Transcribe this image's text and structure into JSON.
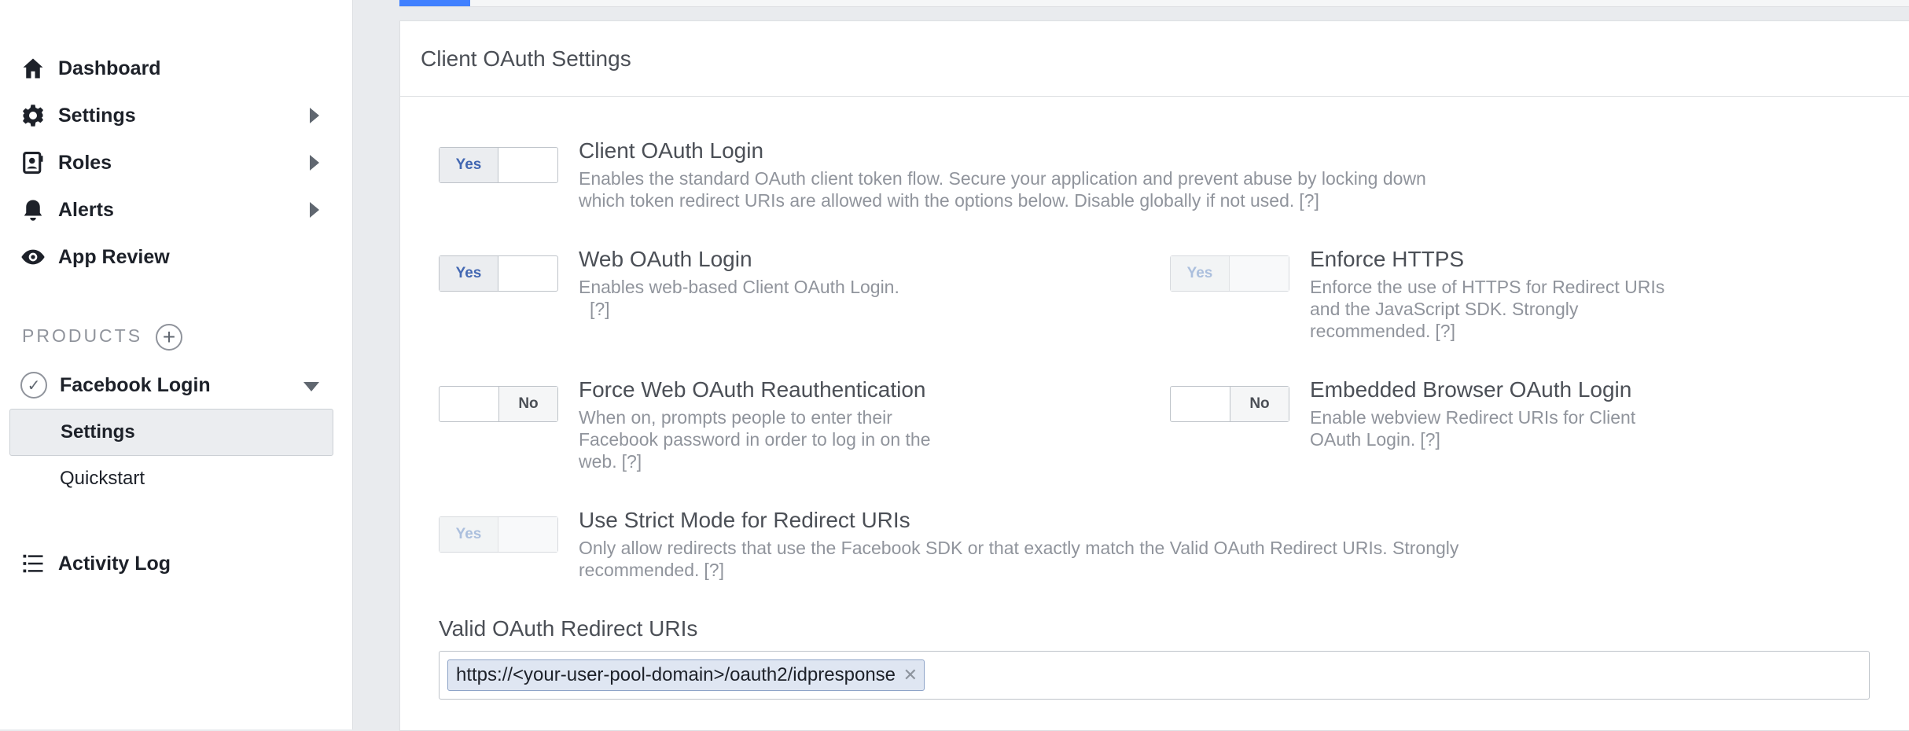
{
  "sidebar": {
    "nav": [
      {
        "label": "Dashboard",
        "icon": "home-icon"
      },
      {
        "label": "Settings",
        "icon": "gear-icon"
      },
      {
        "label": "Roles",
        "icon": "roles-icon"
      },
      {
        "label": "Alerts",
        "icon": "bell-icon"
      },
      {
        "label": "App Review",
        "icon": "eye-icon"
      }
    ],
    "products_label": "PRODUCTS",
    "product": {
      "label": "Facebook Login",
      "sub_items": [
        {
          "label": "Settings",
          "active": true
        },
        {
          "label": "Quickstart",
          "active": false
        }
      ]
    },
    "activity_log": "Activity Log"
  },
  "panel": {
    "title": "Client OAuth Settings",
    "options": {
      "client_oauth": {
        "toggle": "Yes",
        "title": "Client OAuth Login",
        "desc": "Enables the standard OAuth client token flow. Secure your application and prevent abuse by locking down which token redirect URIs are allowed with the options below. Disable globally if not used.",
        "help": "[?]"
      },
      "web_oauth": {
        "toggle": "Yes",
        "title": "Web OAuth Login",
        "desc": "Enables web-based Client OAuth Login.",
        "help": "[?]"
      },
      "enforce_https": {
        "toggle": "Yes",
        "title": "Enforce HTTPS",
        "desc": "Enforce the use of HTTPS for Redirect URIs and the JavaScript SDK. Strongly recommended.",
        "help": "[?]"
      },
      "force_reauth": {
        "toggle": "No",
        "title": "Force Web OAuth Reauthentication",
        "desc": "When on, prompts people to enter their Facebook password in order to log in on the web.",
        "help": "[?]"
      },
      "embedded_browser": {
        "toggle": "No",
        "title": "Embedded Browser OAuth Login",
        "desc": "Enable webview Redirect URIs for Client OAuth Login.",
        "help": "[?]"
      },
      "strict_mode": {
        "toggle": "Yes",
        "title": "Use Strict Mode for Redirect URIs",
        "desc": "Only allow redirects that use the Facebook SDK or that exactly match the Valid OAuth Redirect URIs. Strongly recommended.",
        "help": "[?]"
      }
    },
    "redirect_uris": {
      "label": "Valid OAuth Redirect URIs",
      "tokens": [
        "https://<your-user-pool-domain>/oauth2/idpresponse"
      ],
      "remove_glyph": "✕"
    }
  }
}
